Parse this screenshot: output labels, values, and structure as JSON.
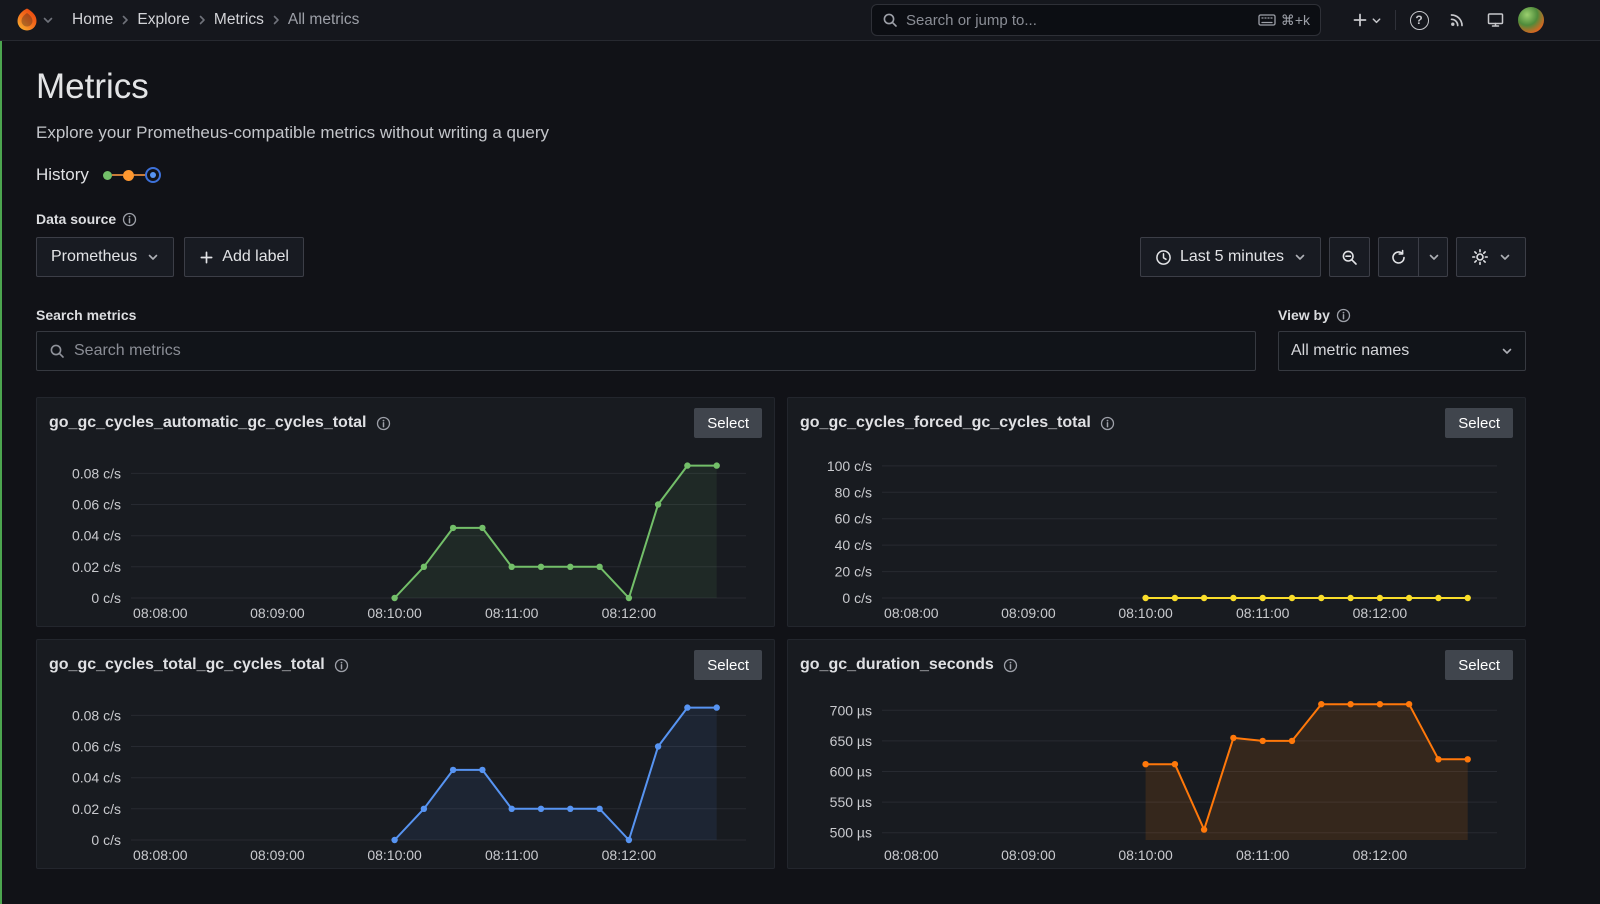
{
  "navbar": {
    "breadcrumbs": [
      {
        "label": "Home"
      },
      {
        "label": "Explore"
      },
      {
        "label": "Metrics"
      },
      {
        "label": "All metrics"
      }
    ],
    "search": {
      "placeholder": "Search or jump to...",
      "shortcut": "⌘+k"
    },
    "help_glyph": "?",
    "icons": [
      "grafana-logo",
      "chevron-down",
      "search",
      "keyboard",
      "plus",
      "question-circle",
      "rss",
      "monitor",
      "avatar"
    ]
  },
  "page": {
    "title": "Metrics",
    "subtitle": "Explore your Prometheus-compatible metrics without writing a query",
    "history_label": "History",
    "datasource_label": "Data source",
    "datasource_value": "Prometheus",
    "add_label": "Add label",
    "time_picker": "Last 5 minutes",
    "search_label": "Search metrics",
    "search_placeholder": "Search metrics",
    "view_by_label": "View by",
    "view_by_value": "All metric names"
  },
  "colors": {
    "green": "#73bf69",
    "yellow": "#fade2a",
    "blue": "#5794f2",
    "orange": "#ff780a",
    "accent_edge": "#4ca54f"
  },
  "panels": [
    {
      "title": "go_gc_cycles_automatic_gc_cycles_total",
      "select_label": "Select",
      "color": "#73bf69",
      "fill_opacity": 0.09,
      "chart_data": {
        "type": "line",
        "unit": "c/s",
        "x_range": [
          -15,
          300
        ],
        "y_range": [
          0,
          0.095
        ],
        "x_ticks": [
          [
            0,
            "08:08:00"
          ],
          [
            60,
            "08:09:00"
          ],
          [
            120,
            "08:10:00"
          ],
          [
            180,
            "08:11:00"
          ],
          [
            240,
            "08:12:00"
          ]
        ],
        "y_ticks": [
          [
            0,
            "0 c/s"
          ],
          [
            0.02,
            "0.02 c/s"
          ],
          [
            0.04,
            "0.04 c/s"
          ],
          [
            0.06,
            "0.06 c/s"
          ],
          [
            0.08,
            "0.08 c/s"
          ]
        ],
        "points": [
          [
            120,
            0
          ],
          [
            135,
            0.02
          ],
          [
            150,
            0.045
          ],
          [
            165,
            0.045
          ],
          [
            180,
            0.02
          ],
          [
            195,
            0.02
          ],
          [
            210,
            0.02
          ],
          [
            225,
            0.02
          ],
          [
            240,
            0
          ],
          [
            255,
            0.06
          ],
          [
            270,
            0.085
          ],
          [
            285,
            0.085
          ]
        ]
      }
    },
    {
      "title": "go_gc_cycles_forced_gc_cycles_total",
      "select_label": "Select",
      "color": "#fade2a",
      "fill_opacity": 0.06,
      "chart_data": {
        "type": "line",
        "unit": "c/s",
        "x_range": [
          -15,
          300
        ],
        "y_range": [
          0,
          112
        ],
        "x_ticks": [
          [
            0,
            "08:08:00"
          ],
          [
            60,
            "08:09:00"
          ],
          [
            120,
            "08:10:00"
          ],
          [
            180,
            "08:11:00"
          ],
          [
            240,
            "08:12:00"
          ]
        ],
        "y_ticks": [
          [
            0,
            "0 c/s"
          ],
          [
            20,
            "20 c/s"
          ],
          [
            40,
            "40 c/s"
          ],
          [
            60,
            "60 c/s"
          ],
          [
            80,
            "80 c/s"
          ],
          [
            100,
            "100 c/s"
          ]
        ],
        "points": [
          [
            120,
            0
          ],
          [
            135,
            0
          ],
          [
            150,
            0
          ],
          [
            165,
            0
          ],
          [
            180,
            0
          ],
          [
            195,
            0
          ],
          [
            210,
            0
          ],
          [
            225,
            0
          ],
          [
            240,
            0
          ],
          [
            255,
            0
          ],
          [
            270,
            0
          ],
          [
            285,
            0
          ]
        ]
      }
    },
    {
      "title": "go_gc_cycles_total_gc_cycles_total",
      "select_label": "Select",
      "color": "#5794f2",
      "fill_opacity": 0.09,
      "chart_data": {
        "type": "line",
        "unit": "c/s",
        "x_range": [
          -15,
          300
        ],
        "y_range": [
          0,
          0.095
        ],
        "x_ticks": [
          [
            0,
            "08:08:00"
          ],
          [
            60,
            "08:09:00"
          ],
          [
            120,
            "08:10:00"
          ],
          [
            180,
            "08:11:00"
          ],
          [
            240,
            "08:12:00"
          ]
        ],
        "y_ticks": [
          [
            0,
            "0 c/s"
          ],
          [
            0.02,
            "0.02 c/s"
          ],
          [
            0.04,
            "0.04 c/s"
          ],
          [
            0.06,
            "0.06 c/s"
          ],
          [
            0.08,
            "0.08 c/s"
          ]
        ],
        "points": [
          [
            120,
            0
          ],
          [
            135,
            0.02
          ],
          [
            150,
            0.045
          ],
          [
            165,
            0.045
          ],
          [
            180,
            0.02
          ],
          [
            195,
            0.02
          ],
          [
            210,
            0.02
          ],
          [
            225,
            0.02
          ],
          [
            240,
            0
          ],
          [
            255,
            0.06
          ],
          [
            270,
            0.085
          ],
          [
            285,
            0.085
          ]
        ]
      }
    },
    {
      "title": "go_gc_duration_seconds",
      "select_label": "Select",
      "color": "#ff780a",
      "fill_opacity": 0.13,
      "chart_data": {
        "type": "line",
        "unit": "µs",
        "x_range": [
          -15,
          300
        ],
        "y_range": [
          488,
          730
        ],
        "x_ticks": [
          [
            0,
            "08:08:00"
          ],
          [
            60,
            "08:09:00"
          ],
          [
            120,
            "08:10:00"
          ],
          [
            180,
            "08:11:00"
          ],
          [
            240,
            "08:12:00"
          ]
        ],
        "y_ticks": [
          [
            500,
            "500 µs"
          ],
          [
            550,
            "550 µs"
          ],
          [
            600,
            "600 µs"
          ],
          [
            650,
            "650 µs"
          ],
          [
            700,
            "700 µs"
          ]
        ],
        "points": [
          [
            120,
            612
          ],
          [
            135,
            612
          ],
          [
            150,
            505
          ],
          [
            165,
            655
          ],
          [
            180,
            650
          ],
          [
            195,
            650
          ],
          [
            210,
            710
          ],
          [
            225,
            710
          ],
          [
            240,
            710
          ],
          [
            255,
            710
          ],
          [
            270,
            620
          ],
          [
            285,
            620
          ]
        ]
      }
    }
  ]
}
